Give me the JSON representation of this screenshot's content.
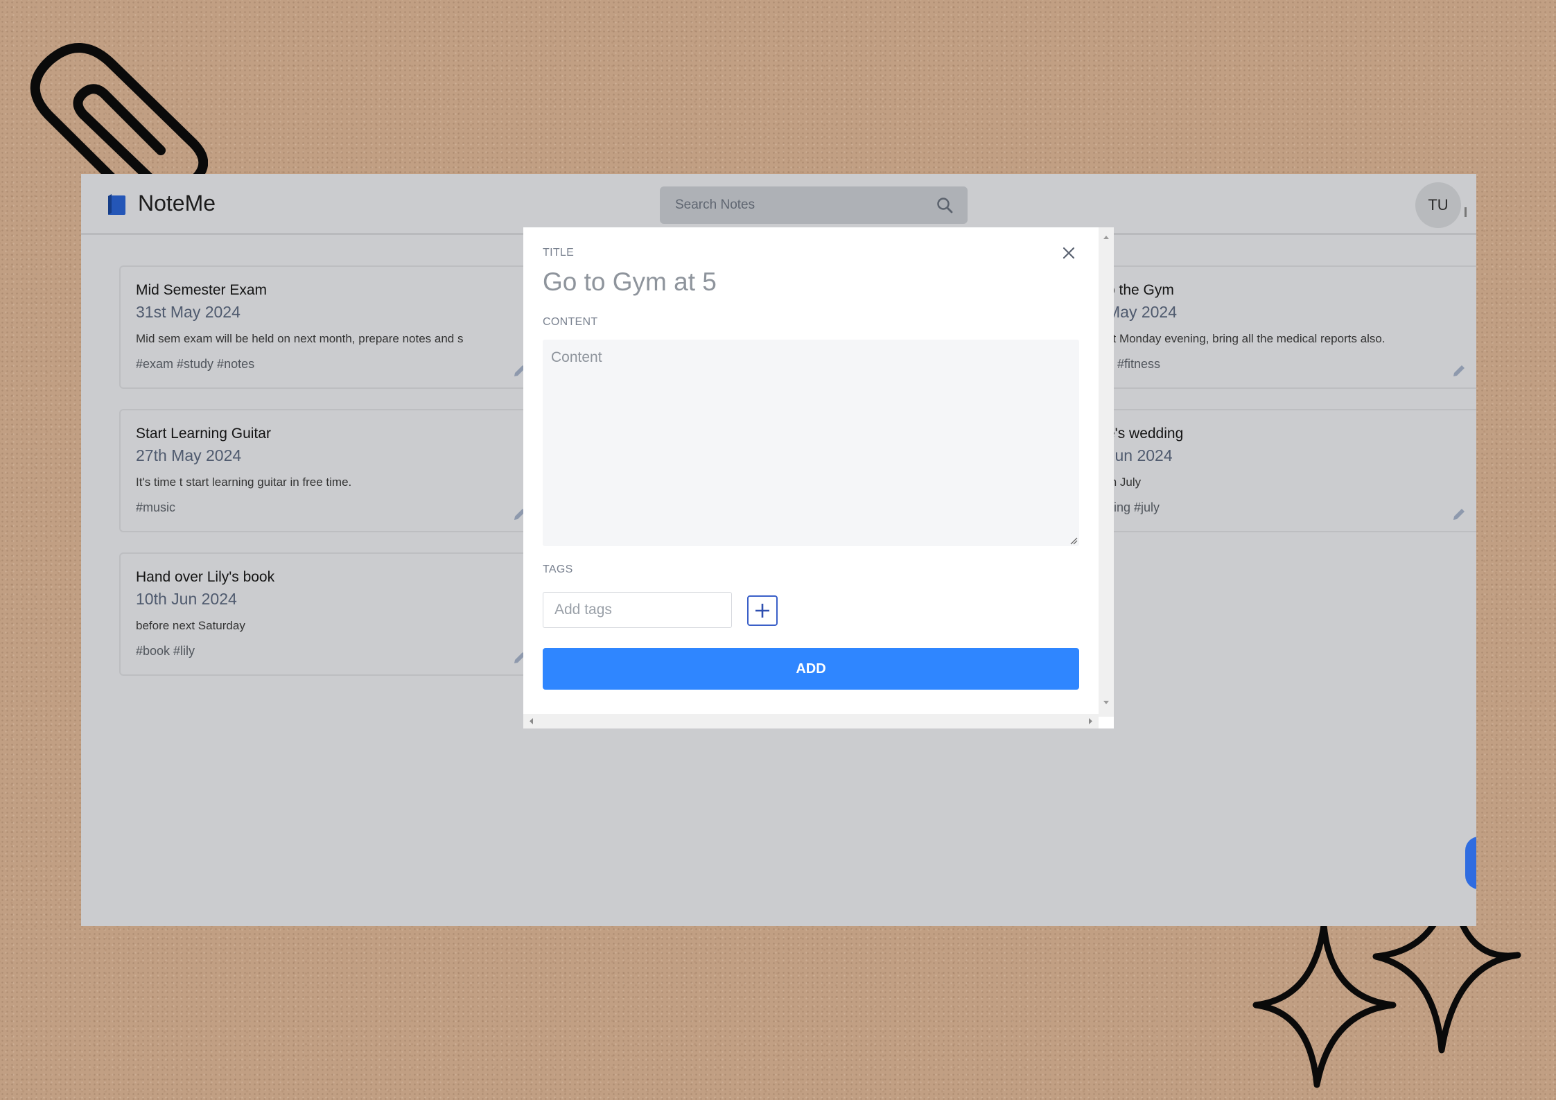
{
  "app": {
    "name": "NoteMe",
    "avatar_initials": "TU",
    "search": {
      "placeholder": "Search Notes"
    }
  },
  "notes": [
    {
      "title": "Mid Semester Exam",
      "date": "31st May 2024",
      "content": "Mid sem exam will be held on next month, prepare notes and s",
      "tags": "#exam #study #notes"
    },
    {
      "title": "Start Learning Guitar",
      "date": "27th May 2024",
      "content": "It's time t start learning guitar in free time.",
      "tags": "#music"
    },
    {
      "title": "Hand over Lily's book",
      "date": "10th Jun 2024",
      "content": "before next Saturday",
      "tags": "#book #lily"
    },
    {
      "title": "o the Gym",
      "date": "May 2024",
      "content": "xt Monday evening, bring all the medical reports also.",
      "tags": "n #fitness"
    },
    {
      "title": "e's wedding",
      "date": "Jun 2024",
      "content": "th July",
      "tags": "ding #july"
    }
  ],
  "modal": {
    "title_label": "TITLE",
    "title_value": "Go to Gym at 5",
    "content_label": "CONTENT",
    "content_placeholder": "Content",
    "tags_label": "TAGS",
    "tags_placeholder": "Add tags",
    "add_button": "ADD"
  },
  "colors": {
    "accent": "#2f86ff",
    "backdrop": "#cbcccf",
    "fab": "#2f6ce0"
  },
  "icons": [
    "paperclip-icon",
    "sparkle-icon",
    "note-logo-icon",
    "search-icon",
    "edit-icon",
    "close-icon",
    "plus-icon"
  ]
}
